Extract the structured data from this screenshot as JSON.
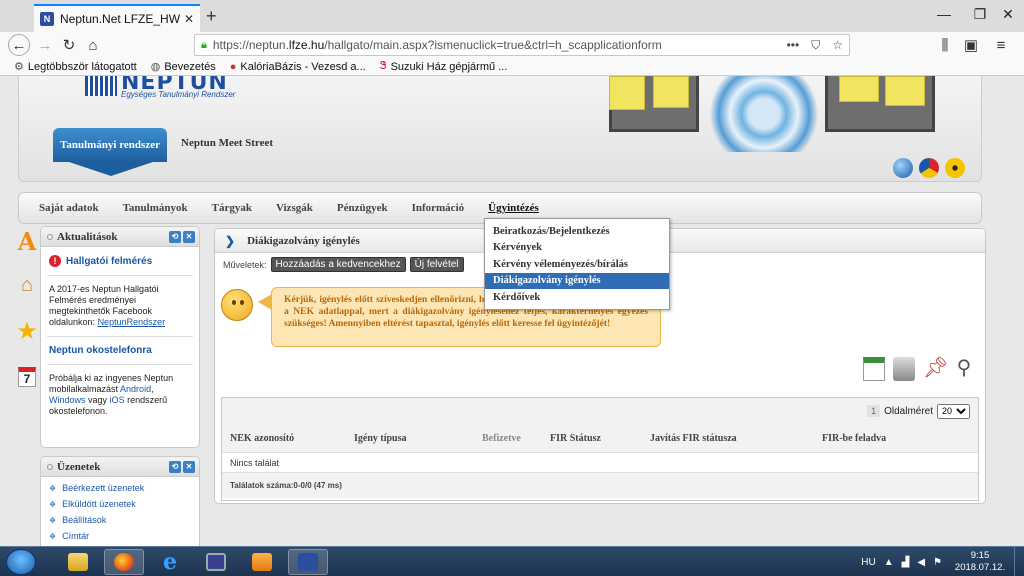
{
  "browser": {
    "tab_title": "Neptun.Net LFZE_HW",
    "tab_favicon": "N",
    "url_prefix": "https://neptun.",
    "url_domain": "lfze.hu",
    "url_path": "/hallgato/main.aspx?ismenuclick=true&ctrl=h_scapplicationform",
    "bookmarks": [
      {
        "icon": "gear-icon",
        "label": "Legtöbbször látogatott"
      },
      {
        "icon": "globe-icon",
        "label": "Bevezetés"
      },
      {
        "icon": "kaloria-icon",
        "label": "KalóriaBázis - Vezesd a..."
      },
      {
        "icon": "suzuki-icon",
        "label": "Suzuki Ház gépjármű ..."
      }
    ]
  },
  "header": {
    "logo_name": "NEPTUN",
    "logo_sub": "Egységes Tanulmányi Rendszer",
    "system_button": "Tanulmányi rendszer",
    "meet_street": "Neptun Meet Street"
  },
  "mainmenu": {
    "items": [
      "Saját adatok",
      "Tanulmányok",
      "Tárgyak",
      "Vizsgák",
      "Pénzügyek",
      "Információ",
      "Ügyintézés"
    ],
    "active_index": 6
  },
  "dropdown": {
    "items": [
      "Beiratkozás/Bejelentkezés",
      "Kérvények",
      "Kérvény véleményezés/bírálás",
      "Diákigazolvány igénylés",
      "Kérdőívek"
    ],
    "selected_index": 3
  },
  "news_panel": {
    "title": "Aktualitások",
    "item1_title": "Hallgatói felmérés",
    "item1_text": "A 2017-es Neptun Hallgatói Felmérés eredményei megtekinthetők Facebook oldalunkon:",
    "item1_link": "NeptunRendszer",
    "item2_title": "Neptun okostelefonra",
    "item2_text_a": "Próbálja ki az ingyenes Neptun mobilalkalmazást",
    "item2_android": "Android",
    "item2_sep": ",",
    "item2_windows": "Windows",
    "item2_or": "vagy",
    "item2_ios": "iOS",
    "item2_text_b": "rendszerű okostelefonon."
  },
  "messages_panel": {
    "title": "Üzenetek",
    "items": [
      "Beérkezett üzenetek",
      "Elküldött üzenetek",
      "Beállítások",
      "Címtár"
    ]
  },
  "content": {
    "title": "Diákigazolvány igénylés",
    "actions_label": "Műveletek:",
    "action_favorites": "Hozzáadás a kedvencekhez",
    "action_new": "Új felvétel",
    "notice": "Kérjük, igénylés előtt szíveskedjen ellenőrizni, hogy a Neptun rendszerben tárolt adatai a NEK adatlappal, mert a diákigazolvány igényléséhez teljes, karakterhelyes egyezés szükséges! Amennyiben eltérést tapasztal, igénylés előtt keresse fel ügyintézőjét!",
    "page_number": "1",
    "page_size_label": "Oldalméret",
    "page_size_value": "20",
    "columns": [
      "NEK azonosító",
      "Igény típusa",
      "Befizetve",
      "FIR Státusz",
      "Javítás FIR státusza",
      "FIR-be feladva"
    ],
    "empty_text": "Nincs találat",
    "result_count": "Találatok száma:0-0/0 (47 ms)"
  },
  "taskbar": {
    "lang": "HU",
    "time": "9:15",
    "date": "2018.07.12."
  }
}
